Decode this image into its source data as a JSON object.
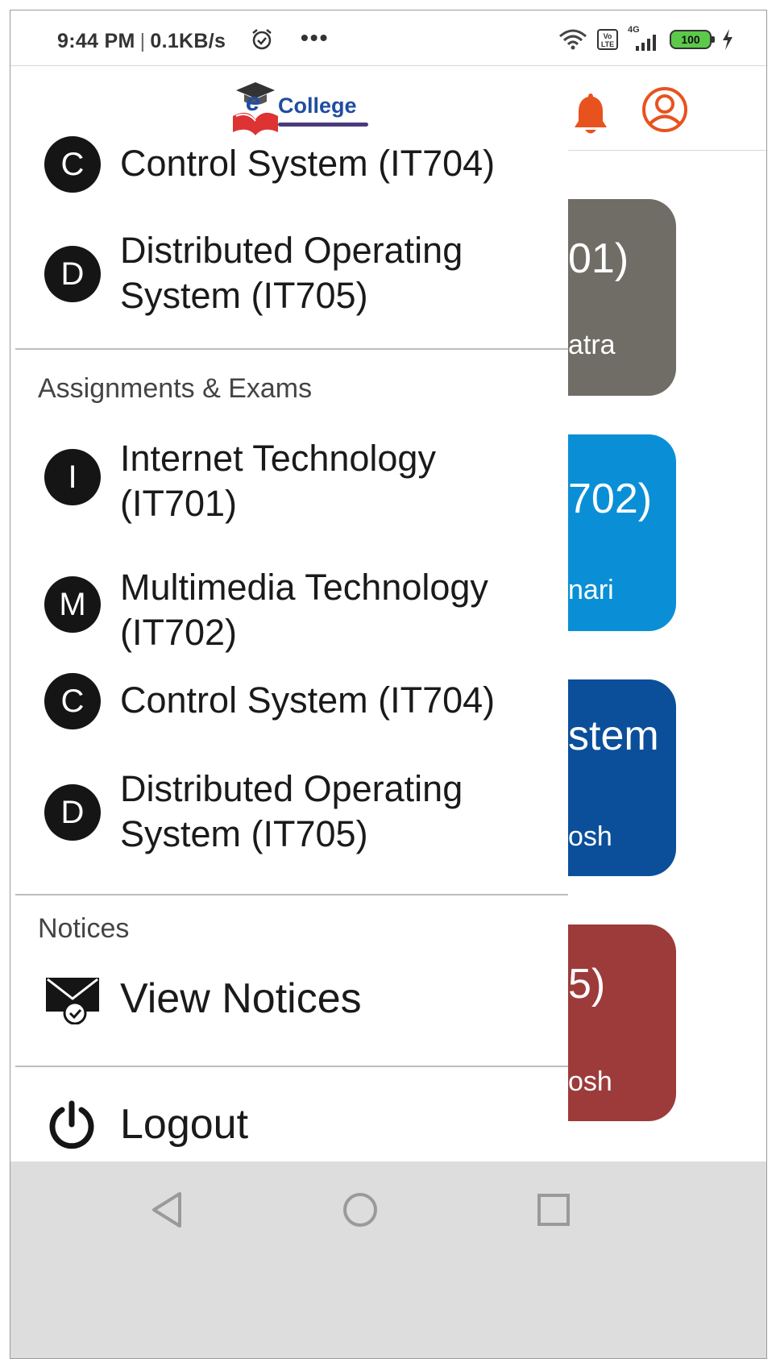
{
  "status_bar": {
    "time": "9:44 PM",
    "speed": "0.1KB/s",
    "menu_dots": "•••",
    "network_label": "4G",
    "volte_label": "Vo LTE",
    "battery": "100"
  },
  "app_bar": {
    "logo_e": "e",
    "logo_text": "College"
  },
  "background_cards": [
    {
      "text1": "01)",
      "text2": "atra",
      "color": "#6f6d65"
    },
    {
      "text1": "702)",
      "text2": "nari",
      "color": "#0a8fd6"
    },
    {
      "text1": "stem",
      "text2": "osh",
      "color": "#0b4f9a"
    },
    {
      "text1": "5)",
      "text2": "osh",
      "color": "#9d3b3b"
    }
  ],
  "drawer": {
    "top_items": [
      {
        "initial": "C",
        "label": "Control System (IT704)"
      },
      {
        "initial": "D",
        "label": "Distributed Operating System (IT705)"
      }
    ],
    "assignments_title": "Assignments & Exams",
    "assignment_items": [
      {
        "initial": "I",
        "label": "Internet Technology (IT701)"
      },
      {
        "initial": "M",
        "label": "Multimedia Technology (IT702)"
      },
      {
        "initial": "C",
        "label": "Control System (IT704)"
      },
      {
        "initial": "D",
        "label": "Distributed Operating System (IT705)"
      }
    ],
    "notices_title": "Notices",
    "view_notices_label": "View Notices",
    "logout_label": "Logout"
  },
  "colors": {
    "accent": "#e8521e",
    "brand_blue": "#1f4ea0",
    "nav_bar": "#dddddd"
  }
}
